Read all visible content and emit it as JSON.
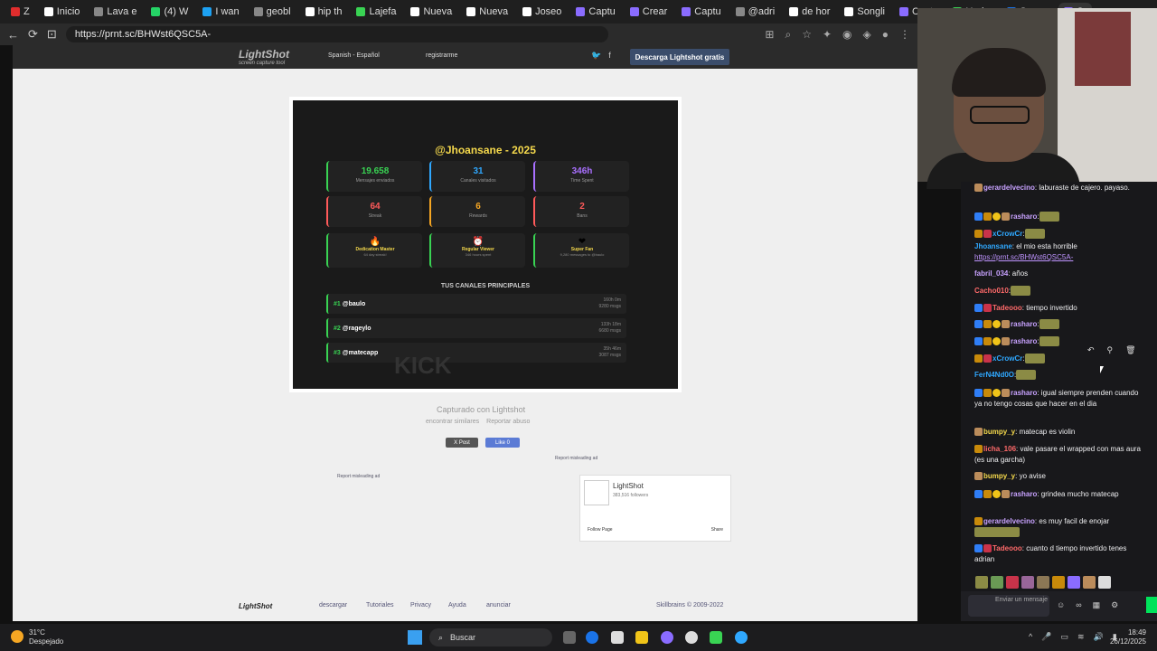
{
  "browser": {
    "tabs": [
      {
        "label": "Z",
        "color": "#e02d2d"
      },
      {
        "label": "Inicio",
        "color": "#ffffff"
      },
      {
        "label": "Lava e",
        "color": "#888888"
      },
      {
        "label": "(4) W",
        "color": "#25d366"
      },
      {
        "label": "I wan",
        "color": "#1da1f2"
      },
      {
        "label": "geobl",
        "color": "#888888"
      },
      {
        "label": "hip th",
        "color": "#ffffff"
      },
      {
        "label": "Lajefa",
        "color": "#39d353"
      },
      {
        "label": "Nueva",
        "color": "#ffffff"
      },
      {
        "label": "Nueva",
        "color": "#ffffff"
      },
      {
        "label": "Joseo",
        "color": "#ffffff"
      },
      {
        "label": "Captu",
        "color": "#8a6cff"
      },
      {
        "label": "Crear",
        "color": "#8a6cff"
      },
      {
        "label": "Captu",
        "color": "#8a6cff"
      },
      {
        "label": "@adri",
        "color": "#888888"
      },
      {
        "label": "de hor",
        "color": "#ffffff"
      },
      {
        "label": "Songli",
        "color": "#ffffff"
      },
      {
        "label": "Captu",
        "color": "#8a6cff"
      },
      {
        "label": "Under",
        "color": "#39d353"
      },
      {
        "label": "Screer",
        "color": "#1a73e8"
      },
      {
        "label": "Cr",
        "color": "#8a6cff"
      }
    ],
    "url": "https://prnt.sc/BHWst6QSC5A-"
  },
  "lightshot": {
    "logo": "LightShot",
    "logo_sub": "screen capture tool",
    "language": "Spanish - Español",
    "register": "registrarme",
    "download": "Descarga Lightshot gratis",
    "caption": "Capturado con Lightshot",
    "find_similar": "encontrar similares",
    "report_abuse": "Reportar abuso",
    "xpost": "X Post",
    "fblike": "Like 0",
    "report_ad_1": "Report misleading ad",
    "report_ad_2": "Report misleading ad",
    "fb_page_name": "LightShot",
    "fb_followers": "383,516 followers",
    "fb_follow": "Follow Page",
    "fb_share": "Share",
    "footer": {
      "logo": "LightShot",
      "links": [
        "descargar",
        "Tutoriales",
        "Privacy",
        "Ayuda",
        "anunciar"
      ],
      "copyright": "Skillbrains © 2009-2022"
    }
  },
  "wrapped": {
    "title": "@Jhoansane - 2025",
    "stats": [
      {
        "value": "19.658",
        "label": "Mensajes enviados",
        "color": "#39d353"
      },
      {
        "value": "31",
        "label": "Canales visitados",
        "color": "#2fa8ff"
      },
      {
        "value": "346h",
        "label": "Time Spent",
        "color": "#a970ff"
      },
      {
        "value": "64",
        "label": "Streak",
        "color": "#ff5a5a"
      },
      {
        "value": "6",
        "label": "Rewards",
        "color": "#f5a623"
      },
      {
        "value": "2",
        "label": "Bans",
        "color": "#ff5a5a"
      }
    ],
    "badges": [
      {
        "icon": "🔥",
        "label": "Dedication Master",
        "sub": "64 day streak!"
      },
      {
        "icon": "⏰",
        "label": "Regular Viewer",
        "sub": "346 hours spent"
      },
      {
        "icon": "❤",
        "label": "Super Fan",
        "sub": "9,280 messages to @baulo"
      }
    ],
    "section": "TUS CANALES PRINCIPALES",
    "channels": [
      {
        "rank": "#1",
        "name": "@baulo",
        "time": "160h 0m",
        "msgs": "9280 msgs"
      },
      {
        "rank": "#2",
        "name": "@rageylo",
        "time": "133h 18m",
        "msgs": "6680 msgs"
      },
      {
        "rank": "#3",
        "name": "@matecapp",
        "time": "35h 46m",
        "msgs": "3087 msgs"
      }
    ],
    "watermark": "KICK"
  },
  "chat": {
    "messages": [
      {
        "user": "gerardelvecino",
        "color": "#c8a2ff",
        "text": ": laburaste de cajero. payaso.",
        "badges": [
          "b4"
        ]
      },
      {
        "user": "rasharo",
        "color": "#c8a2ff",
        "text": ":",
        "badges": [
          "b1",
          "b2",
          "b3",
          "b4"
        ],
        "emote": true
      },
      {
        "user": "xCrowCr",
        "color": "#2fa8ff",
        "text": ":",
        "badges": [
          "b2",
          "b5"
        ],
        "emote": true
      },
      {
        "user": "Jhoansane",
        "color": "#2fa8ff",
        "text": ": el mio esta horrible",
        "badges": []
      },
      {
        "user": "",
        "color": "#bf94ff",
        "text": "https://prnt.sc/BHWst6QSC5A-",
        "badges": [],
        "link": true
      },
      {
        "user": "fabril_034",
        "color": "#c8a2ff",
        "text": ": años",
        "badges": []
      },
      {
        "user": "Cacho010",
        "color": "#ff6a6a",
        "text": ":",
        "badges": [],
        "emote": true
      },
      {
        "user": "Tadeooo",
        "color": "#ff6a6a",
        "text": ": tiempo invertido",
        "badges": [
          "b1",
          "b5"
        ]
      },
      {
        "user": "rasharo",
        "color": "#c8a2ff",
        "text": ":",
        "badges": [
          "b1",
          "b2",
          "b3",
          "b4"
        ],
        "emote": true
      },
      {
        "user": "rasharo",
        "color": "#c8a2ff",
        "text": ":",
        "badges": [
          "b1",
          "b2",
          "b3",
          "b4"
        ],
        "emote": true
      },
      {
        "user": "xCrowCr",
        "color": "#2fa8ff",
        "text": ":",
        "badges": [
          "b2",
          "b5"
        ],
        "emote": true
      },
      {
        "user": "FerN4Nd0O",
        "color": "#2fa8ff",
        "text": ":",
        "badges": [],
        "emote": true
      },
      {
        "user": "rasharo",
        "color": "#c8a2ff",
        "text": ": igual siempre prenden cuando ya no tengo cosas que hacer en el dia",
        "badges": [
          "b1",
          "b2",
          "b3",
          "b4"
        ]
      },
      {
        "user": "bumpy_y",
        "color": "#f5d94c",
        "text": ": matecap es violin",
        "badges": [
          "b4"
        ]
      },
      {
        "user": "licha_106",
        "color": "#ff6a6a",
        "text": ": vale pasare el wrapped con mas aura (es una garcha)",
        "badges": [
          "b2"
        ]
      },
      {
        "user": "bumpy_y",
        "color": "#f5d94c",
        "text": ": yo avise",
        "badges": [
          "b4"
        ]
      },
      {
        "user": "rasharo",
        "color": "#c8a2ff",
        "text": ": grindea mucho matecap",
        "badges": [
          "b1",
          "b2",
          "b3",
          "b4"
        ]
      },
      {
        "user": "gerardelvecino",
        "color": "#c8a2ff",
        "text": ": es muy facil de enojar",
        "badges": [
          "b2"
        ],
        "emote_after": true
      },
      {
        "user": "Tadeooo",
        "color": "#ff6a6a",
        "text": ": cuanto d tiempo invertido tenes adrian",
        "badges": [
          "b1",
          "b5"
        ]
      }
    ],
    "input_placeholder": "Enviar un mensaje"
  },
  "taskbar": {
    "temp": "31°C",
    "weather": "Despejado",
    "search": "Buscar",
    "time": "18:49",
    "date": "26/12/2025"
  }
}
